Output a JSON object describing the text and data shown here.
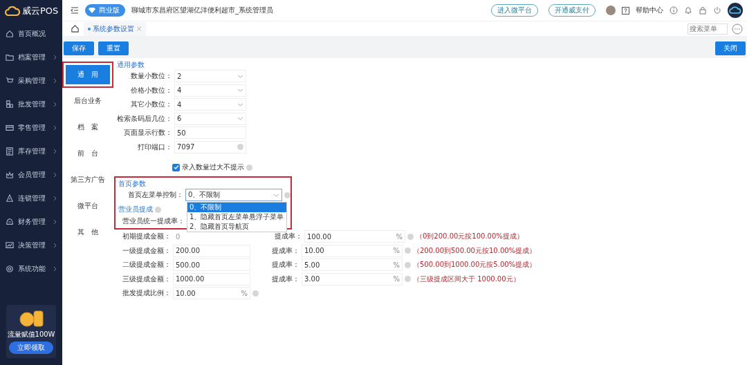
{
  "brand": {
    "name": "威云POS"
  },
  "sidebar": {
    "items": [
      {
        "label": "首页概况",
        "arrow": false
      },
      {
        "label": "档案管理",
        "arrow": true
      },
      {
        "label": "采购管理",
        "arrow": true
      },
      {
        "label": "批发管理",
        "arrow": true
      },
      {
        "label": "零售管理",
        "arrow": true
      },
      {
        "label": "库存管理",
        "arrow": true
      },
      {
        "label": "会员管理",
        "arrow": true
      },
      {
        "label": "连锁管理",
        "arrow": true
      },
      {
        "label": "财务管理",
        "arrow": true
      },
      {
        "label": "决策管理",
        "arrow": true
      },
      {
        "label": "系统功能",
        "arrow": true
      }
    ],
    "promo": {
      "text": "流量赋值100W",
      "button": "立即领取"
    }
  },
  "header": {
    "edition": "商业版",
    "store": "聊城市东昌府区望湖亿洋便利超市_系统管理员",
    "links": [
      "进入微平台",
      "开通威支付"
    ],
    "help": "帮助中心"
  },
  "tabs": [
    {
      "label": "系统参数设置",
      "selected": true,
      "close": "×"
    }
  ],
  "menu_search": {
    "placeholder": "搜索菜单"
  },
  "toolbar": {
    "buttons": [
      "保存",
      "重置"
    ],
    "close": "关闭"
  },
  "categories": [
    {
      "label": "通　用",
      "selected": true,
      "highlighted": true
    },
    {
      "label": "后台业务",
      "selected": false,
      "highlighted": false
    },
    {
      "label": "档　案",
      "selected": false,
      "highlighted": false
    },
    {
      "label": "前　台",
      "selected": false,
      "highlighted": false
    },
    {
      "label": "第三方广告",
      "selected": false,
      "highlighted": false
    },
    {
      "label": "微平台",
      "selected": false,
      "highlighted": false
    },
    {
      "label": "其　他",
      "selected": false,
      "highlighted": false
    }
  ],
  "general": {
    "title": "通用参数",
    "fields": [
      {
        "label": "数量小数位：",
        "value": "2",
        "kind": "select",
        "help": false
      },
      {
        "label": "价格小数位：",
        "value": "4",
        "kind": "select",
        "help": false
      },
      {
        "label": "其它小数位：",
        "value": "4",
        "kind": "select",
        "help": false
      },
      {
        "label": "检索条码后几位：",
        "value": "6",
        "kind": "select",
        "help": false
      },
      {
        "label": "页面显示行数：",
        "value": "50",
        "kind": "input",
        "help": false
      },
      {
        "label": "打印端口：",
        "value": "7097",
        "kind": "input",
        "help": true
      }
    ],
    "checkbox": {
      "label": "录入数量过大不提示",
      "checked": true
    }
  },
  "home": {
    "title": "首页参数",
    "highlighted": true,
    "label": "首页左菜单控制：",
    "value": "0、不限制",
    "expanded": true,
    "options": [
      {
        "label": "0、不限制",
        "selected": true
      },
      {
        "label": "1、隐藏首页左菜单悬浮子菜单",
        "selected": false
      },
      {
        "label": "2、隐藏首页导航页",
        "selected": false
      }
    ]
  },
  "commission": {
    "title": "营业员提成",
    "unified_label": "营业员统一提成率：",
    "tiers": [
      {
        "amount_label": "初期提成金额：",
        "amount": "0",
        "kind": "plain",
        "rate_label": "提成率：",
        "rate": "100.00",
        "unit": "%",
        "note": "（0到200.00元按100.00%提成）"
      },
      {
        "amount_label": "一级提成金额：",
        "amount": "200.00",
        "kind": "input",
        "rate_label": "提成率：",
        "rate": "10.00",
        "unit": "%",
        "note": "（200.00到500.00元按10.00%提成）"
      },
      {
        "amount_label": "二级提成金额：",
        "amount": "500.00",
        "kind": "input",
        "rate_label": "提成率：",
        "rate": "5.00",
        "unit": "%",
        "note": "（500.00到1000.00元按5.00%提成）"
      },
      {
        "amount_label": "三级提成金额：",
        "amount": "1000.00",
        "kind": "input",
        "rate_label": "提成率：",
        "rate": "3.00",
        "unit": "%",
        "note": "（三级提成区间大于 1000.00元）"
      }
    ],
    "wholesale": {
      "label": "批发提成比例：",
      "value": "10.00",
      "unit": "%"
    }
  }
}
